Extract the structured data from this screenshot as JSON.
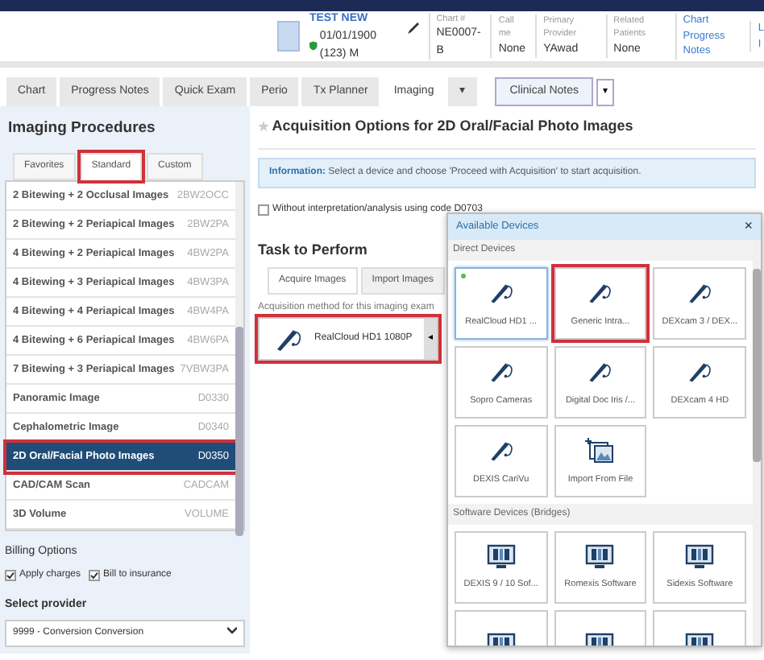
{
  "patient": {
    "name": "TEST NEW",
    "dob": "01/01/1900 (123) M",
    "fields": [
      {
        "label": "Chart #",
        "value": "NE0007-B"
      },
      {
        "label": "Call me",
        "value": "None"
      },
      {
        "label": "Primary Provider",
        "value": "YAwad"
      },
      {
        "label": "Related Patients",
        "value": "None"
      }
    ],
    "links": [
      [
        "Chart",
        "Progress Notes"
      ],
      [
        "L",
        "I"
      ]
    ]
  },
  "tabs": [
    {
      "label": "Chart",
      "selected": false
    },
    {
      "label": "Progress Notes",
      "selected": false
    },
    {
      "label": "Quick Exam",
      "selected": false
    },
    {
      "label": "Perio",
      "selected": false
    },
    {
      "label": "Tx Planner",
      "selected": false
    },
    {
      "label": "Imaging",
      "selected": true
    }
  ],
  "tab_more": "▾",
  "clinical_notes": {
    "label": "Clinical Notes",
    "caret": "▾"
  },
  "sidebar": {
    "title": "Imaging Procedures",
    "tabs": [
      {
        "label": "Favorites",
        "selected": false,
        "highlighted": false
      },
      {
        "label": "Standard",
        "selected": true,
        "highlighted": true
      },
      {
        "label": "Custom",
        "selected": false,
        "highlighted": false
      }
    ],
    "procedures": [
      {
        "name": "2 Bitewing + 2 Occlusal Images",
        "code": "2BW2OCC",
        "selected": false,
        "highlighted": false
      },
      {
        "name": "2 Bitewing + 2 Periapical Images",
        "code": "2BW2PA",
        "selected": false,
        "highlighted": false
      },
      {
        "name": "4 Bitewing + 2 Periapical Images",
        "code": "4BW2PA",
        "selected": false,
        "highlighted": false
      },
      {
        "name": "4 Bitewing + 3 Periapical Images",
        "code": "4BW3PA",
        "selected": false,
        "highlighted": false
      },
      {
        "name": "4 Bitewing + 4 Periapical Images",
        "code": "4BW4PA",
        "selected": false,
        "highlighted": false
      },
      {
        "name": "4 Bitewing + 6 Periapical Images",
        "code": "4BW6PA",
        "selected": false,
        "highlighted": false
      },
      {
        "name": "7 Bitewing + 3 Periapical Images",
        "code": "7VBW3PA",
        "selected": false,
        "highlighted": false
      },
      {
        "name": "Panoramic Image",
        "code": "D0330",
        "selected": false,
        "highlighted": false
      },
      {
        "name": "Cephalometric Image",
        "code": "D0340",
        "selected": false,
        "highlighted": false
      },
      {
        "name": "2D Oral/Facial Photo Images",
        "code": "D0350",
        "selected": true,
        "highlighted": true
      },
      {
        "name": "CAD/CAM Scan",
        "code": "CADCAM",
        "selected": false,
        "highlighted": false
      },
      {
        "name": "3D Volume",
        "code": "VOLUME",
        "selected": false,
        "highlighted": false
      }
    ],
    "billing_title": "Billing Options",
    "billing": [
      {
        "label": "Apply charges",
        "checked": true
      },
      {
        "label": "Bill to insurance",
        "checked": true
      }
    ],
    "provider_label": "Select provider",
    "provider": "9999 - Conversion Conversion"
  },
  "main": {
    "title": "Acquisition Options for 2D Oral/Facial Photo Images",
    "info": "**Information:** Select a device and choose 'Proceed with Acquisition' to start acquisition.",
    "option": {
      "label": "Without interpretation/analysis using code D0703",
      "checked": false
    },
    "task_title": "Task to Perform",
    "task_tabs": [
      {
        "label": "Acquire Images",
        "selected": true
      },
      {
        "label": "Import Images",
        "selected": false
      }
    ],
    "method_label": "Acquisition method for this imaging exam",
    "device": {
      "label": "RealCloud HD1 1080P",
      "highlighted": true,
      "toggle": "◂"
    }
  },
  "popup": {
    "title": "Available Devices",
    "close": "×",
    "groups": [
      {
        "title": "Direct Devices",
        "devices": [
          {
            "kind": "camera",
            "label": "RealCloud HD1 ...",
            "connected": true,
            "selected": true,
            "highlighted": false
          },
          {
            "kind": "camera",
            "label": "Generic Intra...",
            "connected": false,
            "selected": false,
            "highlighted": true
          },
          {
            "kind": "camera",
            "label": "DEXcam 3 / DEX...",
            "connected": false,
            "selected": false,
            "highlighted": false
          },
          {
            "kind": "camera",
            "label": "Sopro Cameras",
            "connected": false,
            "selected": false,
            "highlighted": false
          },
          {
            "kind": "camera",
            "label": "Digital Doc Iris /...",
            "connected": false,
            "selected": false,
            "highlighted": false
          },
          {
            "kind": "camera",
            "label": "DEXcam 4 HD",
            "connected": false,
            "selected": false,
            "highlighted": false
          },
          {
            "kind": "camera",
            "label": "DEXIS CariVu",
            "connected": false,
            "selected": false,
            "highlighted": false
          },
          {
            "kind": "import",
            "label": "Import From File",
            "connected": false,
            "selected": false,
            "highlighted": false
          }
        ]
      },
      {
        "title": "Software Devices (Bridges)",
        "devices": [
          {
            "kind": "bridge",
            "label": "DEXIS 9 / 10 Sof...",
            "connected": false,
            "selected": false,
            "highlighted": false
          },
          {
            "kind": "bridge",
            "label": "Romexis Software",
            "connected": false,
            "selected": false,
            "highlighted": false
          },
          {
            "kind": "bridge",
            "label": "Sidexis Software",
            "connected": false,
            "selected": false,
            "highlighted": false
          },
          {
            "kind": "bridge",
            "connected": false,
            "selected": false,
            "highlighted": false
          },
          {
            "kind": "bridge",
            "connected": false,
            "selected": false,
            "highlighted": false
          },
          {
            "kind": "bridge",
            "connected": false,
            "selected": false,
            "highlighted": false
          }
        ]
      }
    ]
  }
}
